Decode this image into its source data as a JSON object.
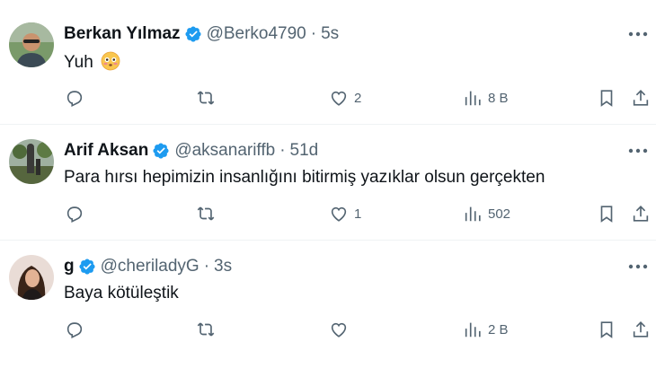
{
  "tweets": [
    {
      "name": "Berkan Yılmaz",
      "handle": "@Berko4790",
      "separator": "·",
      "time": "5s",
      "text": "Yuh",
      "has_emoji": true,
      "likes": "2",
      "views": "8 B",
      "avatar_icon": "avatar-man-outdoor",
      "verified": true
    },
    {
      "name": "Arif Aksan",
      "handle": "@aksanariffb",
      "separator": "·",
      "time": "51d",
      "text": "Para hırsı hepimizin insanlığını bitirmiş yazıklar olsun gerçekten",
      "has_emoji": false,
      "likes": "1",
      "views": "502",
      "avatar_icon": "avatar-statue",
      "verified": true
    },
    {
      "name": "g",
      "handle": "@cheriladyG",
      "separator": "·",
      "time": "3s",
      "text": "Baya kötüleştik",
      "has_emoji": false,
      "likes": "",
      "views": "2 B",
      "avatar_icon": "avatar-woman",
      "verified": true
    }
  ],
  "colors": {
    "verified": "#1d9bf0",
    "secondary_text": "#536471",
    "primary_text": "#0f1419",
    "divider": "#eff3f4"
  },
  "icons": [
    "reply-icon",
    "retweet-icon",
    "like-icon",
    "views-icon",
    "bookmark-icon",
    "share-icon",
    "more-icon",
    "verified-badge-icon",
    "flushed-face-emoji"
  ]
}
